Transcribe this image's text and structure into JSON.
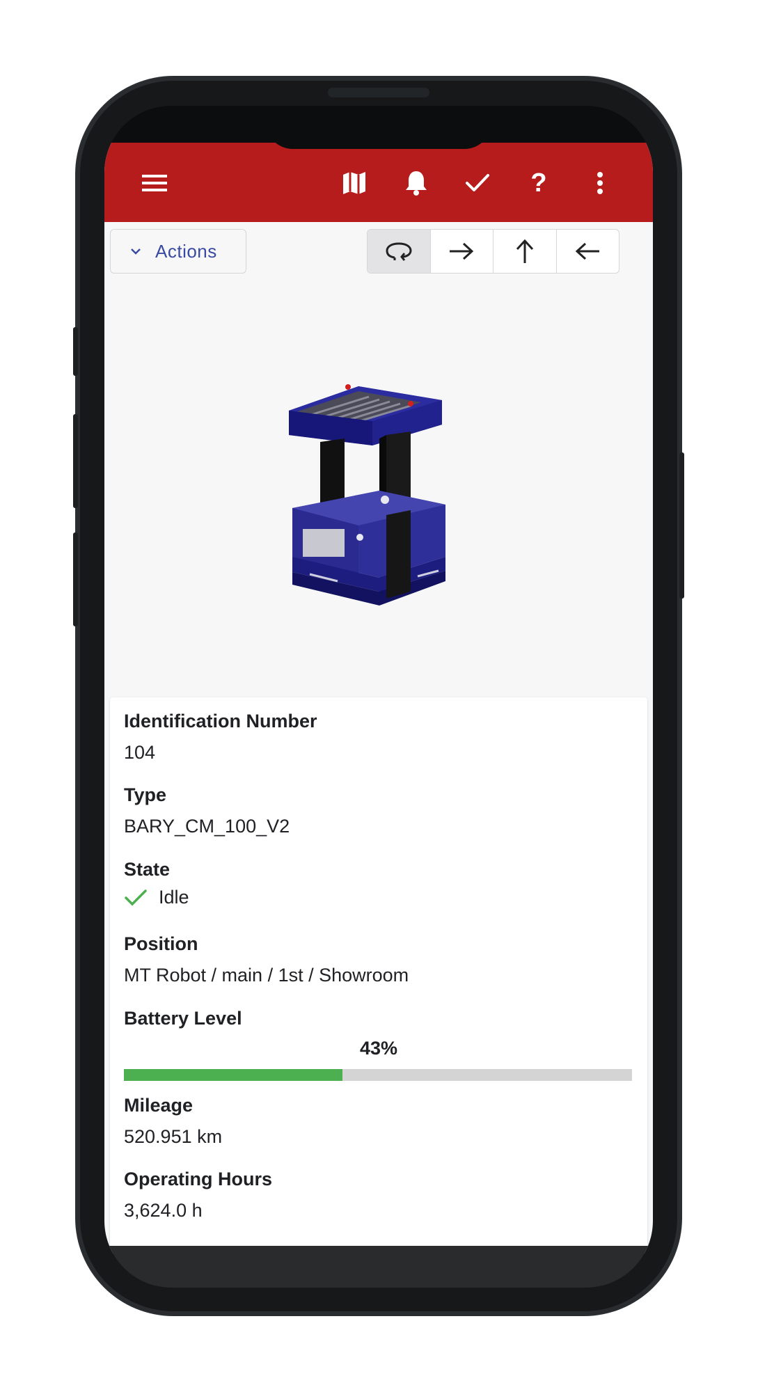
{
  "appbar": {
    "menu_icon": "hamburger-menu-icon",
    "icons": [
      "map-icon",
      "bell-icon",
      "check-icon",
      "help-icon",
      "more-vert-icon"
    ],
    "help_glyph": "?",
    "color": "#b61c1c"
  },
  "toolbar": {
    "actions_label": "Actions",
    "actions_icon": "chevron-down-icon",
    "segments": [
      {
        "icon": "rotate-icon",
        "active": true
      },
      {
        "icon": "arrow-right-icon",
        "active": false
      },
      {
        "icon": "arrow-up-icon",
        "active": false
      },
      {
        "icon": "arrow-left-icon",
        "active": false
      }
    ]
  },
  "robot_image": "robot-3d-model",
  "details": {
    "id_label": "Identification Number",
    "id_value": "104",
    "type_label": "Type",
    "type_value": "BARY_CM_100_V2",
    "state_label": "State",
    "state_value": "Idle",
    "state_icon": "check-icon",
    "position_label": "Position",
    "position_value": "MT Robot / main / 1st / Showroom",
    "battery_label": "Battery Level",
    "battery_text": "43%",
    "battery_fraction": 0.43,
    "battery_color": "#4caf50",
    "mileage_label": "Mileage",
    "mileage_value": "520.951 km",
    "hours_label": "Operating Hours",
    "hours_value": "3,624.0 h"
  }
}
